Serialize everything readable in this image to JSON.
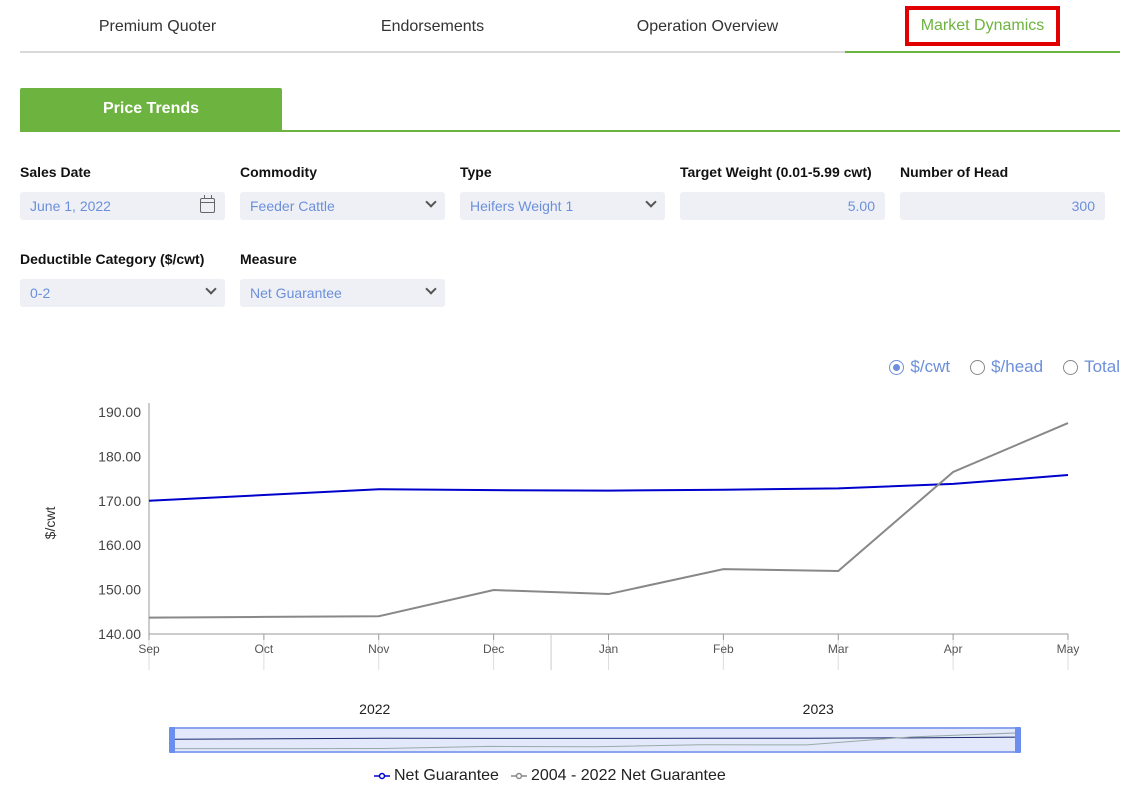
{
  "tabs": [
    {
      "label": "Premium Quoter"
    },
    {
      "label": "Endorsements"
    },
    {
      "label": "Operation Overview"
    },
    {
      "label": "Market Dynamics"
    }
  ],
  "subtab": {
    "label": "Price Trends"
  },
  "form": {
    "sales_date": {
      "label": "Sales Date",
      "value": "June 1, 2022"
    },
    "commodity": {
      "label": "Commodity",
      "value": "Feeder Cattle"
    },
    "type": {
      "label": "Type",
      "value": "Heifers Weight 1"
    },
    "target_weight": {
      "label": "Target Weight (0.01-5.99 cwt)",
      "value": "5.00"
    },
    "number_of_head": {
      "label": "Number of Head",
      "value": "300"
    },
    "deductible": {
      "label": "Deductible Category ($/cwt)",
      "value": "0-2"
    },
    "measure": {
      "label": "Measure",
      "value": "Net Guarantee"
    }
  },
  "units": {
    "options": [
      {
        "label": "$/cwt",
        "selected": true
      },
      {
        "label": "$/head",
        "selected": false
      },
      {
        "label": "Total",
        "selected": false
      }
    ]
  },
  "colors": {
    "accent": "#6db33f",
    "highlight": "#e00000",
    "link": "#6c8fdc",
    "series_net": "#0000cc",
    "series_hist": "#888888"
  },
  "chart_data": {
    "type": "line",
    "ylabel": "$/cwt",
    "ylim": [
      140,
      190
    ],
    "yticks": [
      "190.00",
      "180.00",
      "170.00",
      "160.00",
      "150.00",
      "140.00"
    ],
    "categories": [
      "Sep",
      "Oct",
      "Nov",
      "Dec",
      "Jan",
      "Feb",
      "Mar",
      "Apr",
      "May"
    ],
    "years": [
      "2022",
      "2023"
    ],
    "series": [
      {
        "name": "Net Guarantee",
        "values": [
          170.0,
          171.3,
          172.6,
          172.4,
          172.3,
          172.5,
          172.8,
          173.8,
          175.8
        ]
      },
      {
        "name": "2004 - 2022 Net Guarantee",
        "values": [
          143.7,
          null,
          144.0,
          149.9,
          149.0,
          154.6,
          154.2,
          176.5,
          187.5
        ]
      }
    ],
    "grid": false,
    "legend": "bottom"
  }
}
